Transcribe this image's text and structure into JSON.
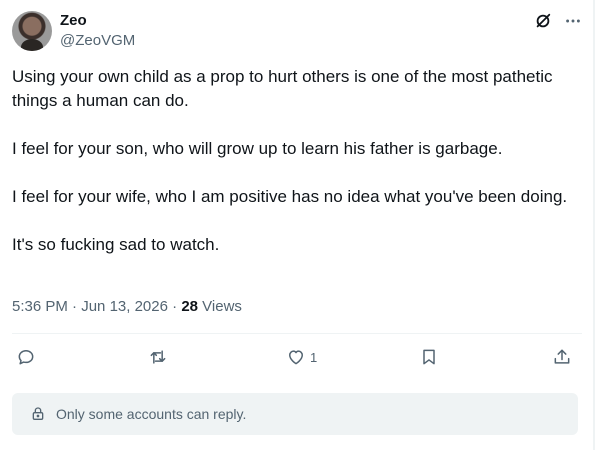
{
  "author": {
    "display_name": "Zeo",
    "handle": "@ZeoVGM"
  },
  "header_icons": [
    "grok-icon",
    "more-icon"
  ],
  "tweet": {
    "paragraphs": [
      "Using your own child as a prop to hurt others is one of the most pathetic things a human can do.",
      "I feel for your son, who will grow up to learn his father is garbage.",
      "I feel for your wife, who I am positive has no idea what you've been doing.",
      "It's so fucking sad to watch."
    ]
  },
  "meta": {
    "time": "5:36 PM",
    "separator": " · ",
    "date": "Jun 13, 2026",
    "views_count": "28",
    "views_label": " Views"
  },
  "actions": {
    "reply_count": "",
    "repost_count": "",
    "like_count": "1",
    "bookmark_count": "",
    "icons": [
      "reply-icon",
      "repost-icon",
      "like-icon",
      "bookmark-icon",
      "share-icon"
    ]
  },
  "reply_restriction": {
    "text": "Only some accounts can reply.",
    "icon": "lock-icon"
  },
  "colors": {
    "text_primary": "#0f1419",
    "text_secondary": "#536471",
    "divider": "#eff3f4",
    "reply_box_bg": "#eff3f4"
  }
}
